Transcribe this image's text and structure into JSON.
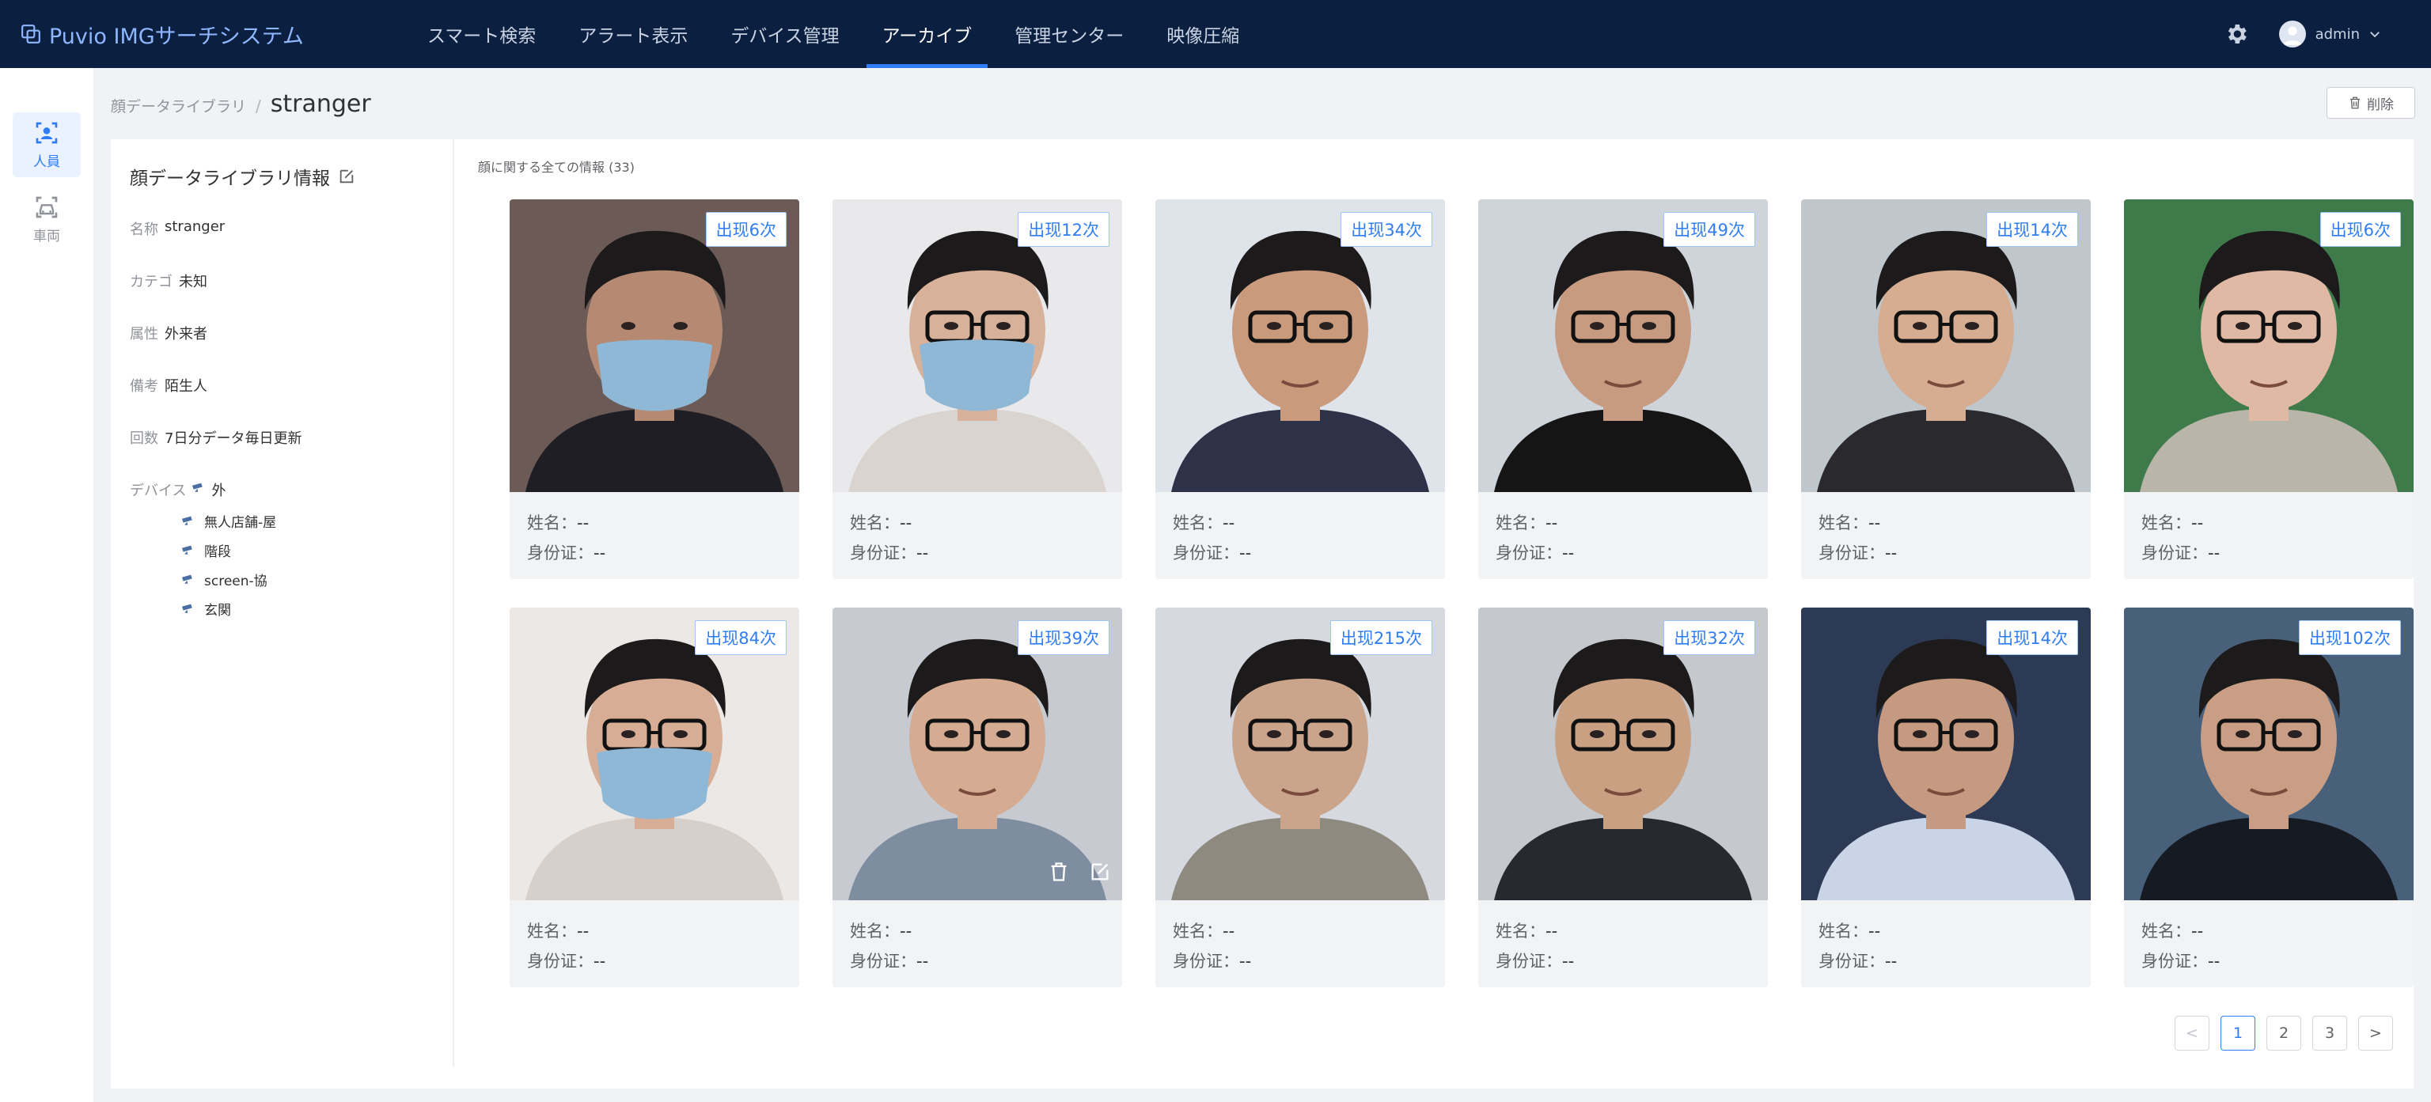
{
  "app": {
    "title": "Puvio IMGサーチシステム"
  },
  "nav": {
    "items": [
      {
        "label": "スマート検索",
        "active": false
      },
      {
        "label": "アラート表示",
        "active": false
      },
      {
        "label": "デバイス管理",
        "active": false
      },
      {
        "label": "アーカイブ",
        "active": true
      },
      {
        "label": "管理センター",
        "active": false
      },
      {
        "label": "映像圧縮",
        "active": false
      }
    ]
  },
  "user": {
    "name": "admin",
    "avatar_icon": "user-avatar-icon",
    "settings_icon": "gear-icon"
  },
  "rail": {
    "items": [
      {
        "label": "人員",
        "icon": "person-icon",
        "active": true
      },
      {
        "label": "車両",
        "icon": "vehicle-icon",
        "active": false
      }
    ]
  },
  "breadcrumb": {
    "parent": "顔データライブラリ",
    "separator": "/",
    "current": "stranger"
  },
  "toolbar": {
    "delete_label": "削除"
  },
  "info": {
    "title": "顔データライブラリ情報",
    "fields": [
      {
        "label": "名称",
        "value": "stranger"
      },
      {
        "label": "カテゴ",
        "value": "未知"
      },
      {
        "label": "属性",
        "value": "外来者"
      },
      {
        "label": "備考",
        "value": "陌生人"
      },
      {
        "label": "回数",
        "value": "7日分データ毎日更新"
      }
    ],
    "device_label": "デバイス",
    "device_root": "外",
    "devices": [
      "無人店舗-屋",
      "階段",
      "screen-協",
      "玄関"
    ]
  },
  "results": {
    "header": "顔に関する全ての情報 (33)",
    "name_label": "姓名：",
    "id_label": "身份证：",
    "cards": [
      {
        "badge": "出现6次",
        "name": "--",
        "id": "--",
        "skin": "#b68a72",
        "bg": "#6b5a55",
        "shirt": "#1e1e24",
        "mask": true,
        "glasses": false
      },
      {
        "badge": "出现12次",
        "name": "--",
        "id": "--",
        "skin": "#d8b19a",
        "bg": "#e9e9ec",
        "shirt": "#d9d4d0",
        "mask": true,
        "glasses": true
      },
      {
        "badge": "出现34次",
        "name": "--",
        "id": "--",
        "skin": "#c99a7c",
        "bg": "#dfe3ea",
        "shirt": "#2d3248",
        "mask": false,
        "glasses": true
      },
      {
        "badge": "出现49次",
        "name": "--",
        "id": "--",
        "skin": "#c89b80",
        "bg": "#cfd4da",
        "shirt": "#151515",
        "mask": false,
        "glasses": true
      },
      {
        "badge": "出现14次",
        "name": "--",
        "id": "--",
        "skin": "#d7ad92",
        "bg": "#bfc6cc",
        "shirt": "#2a2a2e",
        "mask": false,
        "glasses": true
      },
      {
        "badge": "出现6次",
        "name": "--",
        "id": "--",
        "skin": "#e0b9a5",
        "bg": "#3f7a4a",
        "shirt": "#b9b5a8",
        "mask": false,
        "glasses": true
      },
      {
        "badge": "出现84次",
        "name": "--",
        "id": "--",
        "skin": "#d7ae95",
        "bg": "#ece8e6",
        "shirt": "#d6cfca",
        "mask": true,
        "glasses": true
      },
      {
        "badge": "出现39次",
        "name": "--",
        "id": "--",
        "skin": "#d5ac92",
        "bg": "#c7cbd1",
        "shirt": "#7e8ea0",
        "mask": false,
        "glasses": true,
        "tools": true
      },
      {
        "badge": "出现215次",
        "name": "--",
        "id": "--",
        "skin": "#caa58b",
        "bg": "#d6d9df",
        "shirt": "#8e8a80",
        "mask": false,
        "glasses": true
      },
      {
        "badge": "出现32次",
        "name": "--",
        "id": "--",
        "skin": "#caa083",
        "bg": "#c5c8cc",
        "shirt": "#262a30",
        "mask": false,
        "glasses": true
      },
      {
        "badge": "出现14次",
        "name": "--",
        "id": "--",
        "skin": "#c69a80",
        "bg": "#2c3a55",
        "shirt": "#c9d4e6",
        "mask": false,
        "glasses": true
      },
      {
        "badge": "出现102次",
        "name": "--",
        "id": "--",
        "skin": "#c99e84",
        "bg": "#48607a",
        "shirt": "#161a22",
        "mask": false,
        "glasses": true
      }
    ]
  },
  "pagination": {
    "prev": "<",
    "next": ">",
    "pages": [
      "1",
      "2",
      "3"
    ],
    "current": "1"
  },
  "colors": {
    "nav_bg": "#0b1f40",
    "accent": "#2f7df6",
    "card_bg": "#f2f3f5"
  }
}
